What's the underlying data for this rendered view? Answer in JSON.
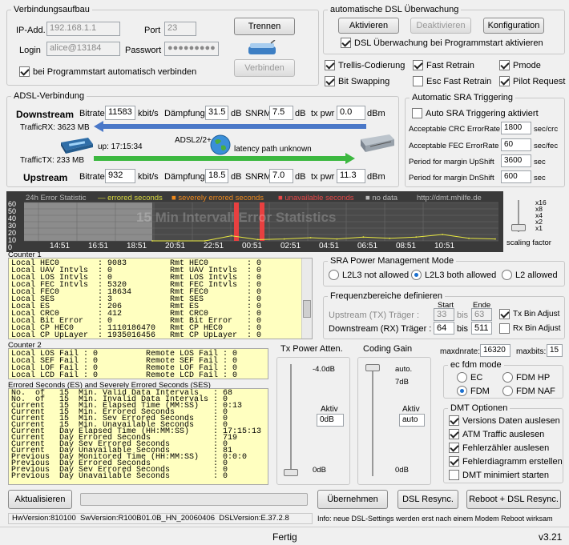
{
  "conn": {
    "legend": "Verbindungsaufbau",
    "ip_label": "IP-Add.",
    "ip": "192.168.1.1",
    "port_label": "Port",
    "port": "23",
    "login_label": "Login",
    "login": "alice@13184",
    "pw_label": "Passwort",
    "pw": "●●●●●●●●●",
    "disconnect": "Trennen",
    "connect": "Verbinden",
    "auto_connect": "bei Programmstart automatisch verbinden"
  },
  "monitor": {
    "legend": "automatische DSL Überwachung",
    "activate": "Aktivieren",
    "deactivate": "Deaktivieren",
    "config": "Konfiguration",
    "on_start": "DSL Überwachung bei Programmstart aktivieren"
  },
  "opts": {
    "trellis": "Trellis-Codierung",
    "fast_retrain": "Fast Retrain",
    "pmode": "Pmode",
    "bitswap": "Bit Swapping",
    "esc_fast_retrain": "Esc Fast Retrain",
    "pilot": "Pilot Request"
  },
  "adsl": {
    "legend": "ADSL-Verbindung",
    "downstream": "Downstream",
    "upstream": "Upstream",
    "bitrate_label": "Bitrate",
    "bitrate_unit": "kbit/s",
    "damp_label": "Dämpfung",
    "db": "dB",
    "snrm_label": "SNRM",
    "txpwr_label": "tx pwr",
    "dbm": "dBm",
    "down_bitrate": "11583",
    "down_damp": "31.5",
    "down_snrm": "7.5",
    "down_txpwr": "0.0",
    "up_bitrate": "932",
    "up_damp": "18.5",
    "up_snrm": "7.0",
    "up_txpwr": "11.3",
    "traffic_rx": "TrafficRX: 3623 MB",
    "traffic_tx": "TrafficTX: 233 MB",
    "uptime": "up: 17:15:34",
    "mode": "ADSL2/2+",
    "latency": "latency path unknown"
  },
  "sra": {
    "legend": "Automatic SRA Triggering",
    "auto": "Auto SRA Triggering aktiviert",
    "crc_label": "Acceptable CRC ErrorRate",
    "crc": "1800",
    "crc_unit": "sec/crc",
    "fec_label": "Acceptable FEC ErrorRate",
    "fec": "60",
    "fec_unit": "sec/fec",
    "up_label": "Period for margin UpShift",
    "up": "3600",
    "dn_label": "Period for margin DnShift",
    "dn": "600",
    "sec": "sec"
  },
  "chart": {
    "title": "24h Error Statistic",
    "legend_err": "errored seconds",
    "legend_sev": "severely errored seconds",
    "legend_unav": "unavailable seconds",
    "legend_nodata": "no data",
    "url": "http://dmt.mhilfe.de",
    "watermark": "15 Min Intervall Error Statistics",
    "yticks": [
      "60",
      "50",
      "40",
      "30",
      "20",
      "10",
      "0"
    ],
    "xticks": [
      "14:51",
      "16:51",
      "18:51",
      "20:51",
      "22:51",
      "00:51",
      "02:51",
      "04:51",
      "06:51",
      "08:51",
      "10:51"
    ],
    "scale": [
      "x16",
      "x8",
      "x4",
      "x2",
      "x1"
    ],
    "scaling_label": "scaling factor"
  },
  "chart_data": {
    "type": "line",
    "title": "24h Error Statistic",
    "xlabel": "",
    "ylabel": "",
    "ylim": [
      0,
      60
    ],
    "categories": [
      "14:51",
      "16:51",
      "18:51",
      "20:51",
      "22:51",
      "00:51",
      "02:51",
      "04:51",
      "06:51",
      "08:51",
      "10:51"
    ],
    "series": [
      {
        "name": "errored seconds",
        "values": [
          0,
          0,
          0,
          8,
          2,
          3,
          5,
          3,
          6,
          4,
          6,
          10,
          4,
          3
        ]
      },
      {
        "name": "unavailable seconds",
        "values": [
          60,
          60
        ]
      }
    ]
  },
  "counter1": {
    "label": "Counter 1",
    "text": "Local HEC0        : 9083         Rmt HEC0        : 0\nLocal UAV Intvls  : 0            Rmt UAV Intvls  : 0\nLocal LOS Intvls  : 0            Rmt LOS Intvls  : 0\nLocal FEC Intvls  : 5320         Rmt FEC Intvls  : 0\nLocal FEC0        : 18634        Rmt FEC0        : 0\nLocal SES         : 3            Rmt SES         : 0\nLocal ES          : 206          Rmt ES          : 0\nLocal CRC0        : 412          Rmt CRC0        : 0\nLocal Bit Error   : 0            Rmt Bit Error   : 0\nLocal CP HEC0     : 1110186470   Rmt CP HEC0     : 0\nLocal CP UpLayer  : 1935016456   Rmt CP UpLayer  : 0"
  },
  "counter2": {
    "label": "Counter 2",
    "text": "Local LOS Fail : 0          Remote LOS Fail : 0\nLocal SEF Fail : 0          Remote SEF Fail : 0\nLocal LOF Fail : 0          Remote LOF Fail : 0\nLocal LCD Fail : 0          Remote LCD Fail : 0"
  },
  "ses": {
    "label": "Errored Seconds (ES) and Severely Errored Seconds (SES)",
    "text": "No.  of   15  Min. Valid Data Intervals   : 68\nNo.  of   15  Min. Invalid Data Intervals : 0\nCurrent   15  Min. Elapsed Time (MM:SS)   : 0:13\nCurrent   15  Min. Errored Seconds        : 0\nCurrent   15  Min. Sev Errored Seconds    : 0\nCurrent   15  Min. Unavailable Seconds    : 0\nCurrent   Day Elapsed Time (HH:MM:SS)     : 17:15:13\nCurrent   Day Errored Seconds             : 719\nCurrent   Day Sev Errored Seconds         : 0\nCurrent   Day Unavailable Seconds         : 81\nPrevious  Day Monitored Time (HH:MM:SS)   : 0:0:0\nPrevious  Day Errored Seconds             : 0\nPrevious  Day Sev Errored Seconds         : 0\nPrevious  Day Unavailable Seconds         : 0"
  },
  "sramode": {
    "legend": "SRA Power Management Mode",
    "l2l3_not": "L2L3 not allowed",
    "l2l3_both": "L2L3 both allowed",
    "l2": "L2 allowed"
  },
  "freq": {
    "legend": "Frequenzbereiche definieren",
    "start": "Start",
    "end": "Ende",
    "up_label": "Upstream (TX) Träger :",
    "up_start": "33",
    "up_end": "63",
    "bis": "bis",
    "down_label": "Downstream (RX) Träger :",
    "down_start": "64",
    "down_end": "511",
    "tx_adj": "Tx Bin Adjust",
    "rx_adj": "Rx Bin Adjust"
  },
  "txatt": {
    "label": "Tx Power Atten.",
    "top": "-4.0dB",
    "bottom": "0dB",
    "aktiv": "Aktiv",
    "value": "0dB",
    "level_fraction": 0.0
  },
  "gain": {
    "label": "Coding Gain",
    "top": "auto.",
    "mid": "7dB",
    "bottom": "0dB",
    "aktiv": "Aktiv",
    "value": "auto",
    "level_fraction": 1.0
  },
  "maxd": {
    "label": "maxdnrate:",
    "value": "16320",
    "bits_label": "maxbits:",
    "bits": "15"
  },
  "fdm": {
    "legend": "ec fdm mode",
    "ec": "EC",
    "fdm_hp": "FDM HP",
    "fdm": "FDM",
    "fdm_naf": "FDM NAF"
  },
  "dmt": {
    "legend": "DMT Optionen",
    "o1": "Versions Daten auslesen",
    "o2": "ATM Traffic auslesen",
    "o3": "Fehlerzähler auslesen",
    "o4": "Fehlerdiagramm erstellen",
    "o5": "DMT minimiert starten"
  },
  "bottom": {
    "refresh": "Aktualisieren",
    "apply": "Übernehmen",
    "resync": "DSL Resync.",
    "reboot": "Reboot + DSL Resync.",
    "hw": "HwVersion:810100",
    "sw": "SwVersion:R100B01.0B_HN_20060406",
    "dsl": "DSLVersion:E.37.2.8",
    "info": "Info: neue DSL-Settings werden erst nach einem Modem Reboot wirksam",
    "status": "Fertig",
    "version": "v3.21"
  }
}
